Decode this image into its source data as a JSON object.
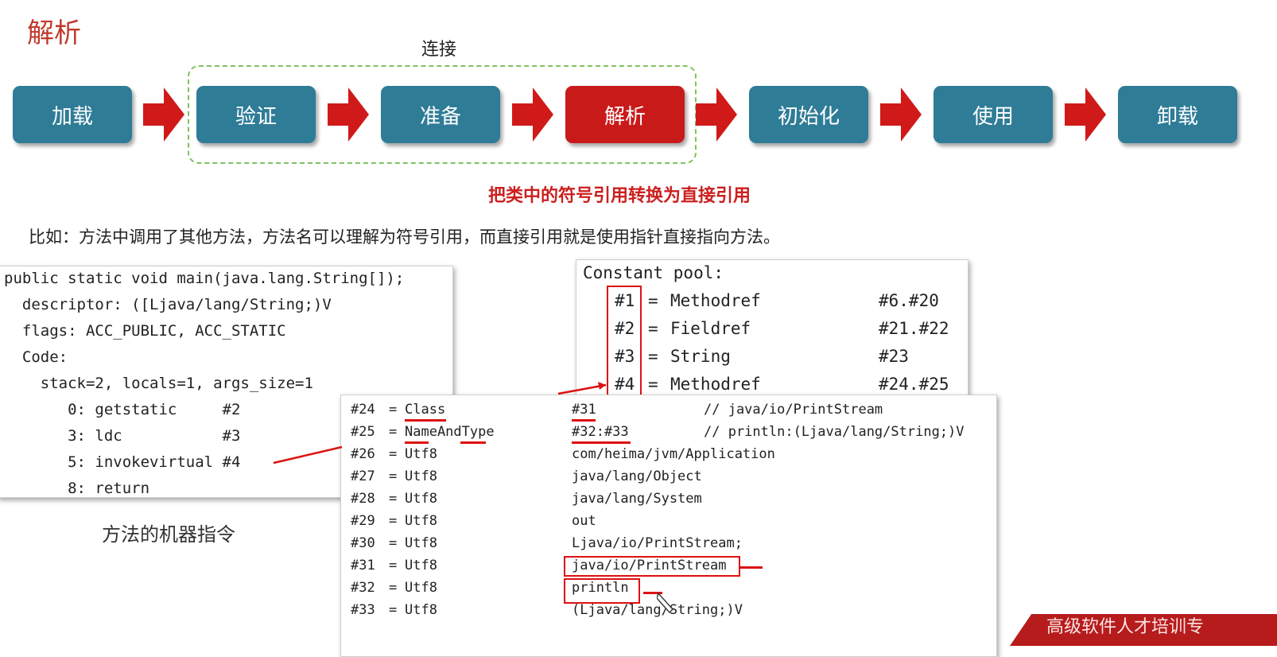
{
  "title": "解析",
  "group_label": "连接",
  "stages": [
    "加载",
    "验证",
    "准备",
    "解析",
    "初始化",
    "使用",
    "卸载"
  ],
  "active_stage": "解析",
  "subtitle": "把类中的符号引用转换为直接引用",
  "example": "比如：方法中调用了其他方法，方法名可以理解为符号引用，而直接引用就是使用指针直接指向方法。",
  "method_code": [
    "public static void main(java.lang.String[]);",
    "  descriptor: ([Ljava/lang/String;)V",
    "  flags: ACC_PUBLIC, ACC_STATIC",
    "  Code:",
    "    stack=2, locals=1, args_size=1",
    "       0: getstatic     #2",
    "       3: ldc           #3",
    "       5: invokevirtual #4",
    "       8: return"
  ],
  "constant_pool": {
    "header": "Constant pool:",
    "rows": [
      {
        "id": "#1",
        "type": "Methodref",
        "ref": "#6.#20"
      },
      {
        "id": "#2",
        "type": "Fieldref",
        "ref": "#21.#22"
      },
      {
        "id": "#3",
        "type": "String",
        "ref": "#23"
      },
      {
        "id": "#4",
        "type": "Methodref",
        "ref": "#24.#25"
      }
    ]
  },
  "pool_entries": [
    {
      "id": "#24",
      "type": "Class",
      "value": "#31",
      "comment": "// java/io/PrintStream"
    },
    {
      "id": "#25",
      "type": "NameAndType",
      "value": "#32:#33",
      "comment": "// println:(Ljava/lang/String;)V"
    },
    {
      "id": "#26",
      "type": "Utf8",
      "value": "com/heima/jvm/Application",
      "comment": ""
    },
    {
      "id": "#27",
      "type": "Utf8",
      "value": "java/lang/Object",
      "comment": ""
    },
    {
      "id": "#28",
      "type": "Utf8",
      "value": "java/lang/System",
      "comment": ""
    },
    {
      "id": "#29",
      "type": "Utf8",
      "value": "out",
      "comment": ""
    },
    {
      "id": "#30",
      "type": "Utf8",
      "value": "Ljava/io/PrintStream;",
      "comment": ""
    },
    {
      "id": "#31",
      "type": "Utf8",
      "value": "java/io/PrintStream",
      "comment": ""
    },
    {
      "id": "#32",
      "type": "Utf8",
      "value": "println",
      "comment": ""
    },
    {
      "id": "#33",
      "type": "Utf8",
      "value": "(Ljava/lang/String;)V",
      "comment": ""
    }
  ],
  "caption": "方法的机器指令",
  "corner_banner": "高级软件人才培训专",
  "colors": {
    "stage": "#2f7c97",
    "active": "#c91a1a",
    "accent_red": "#d11111",
    "dashed_green": "#7dc35b"
  }
}
